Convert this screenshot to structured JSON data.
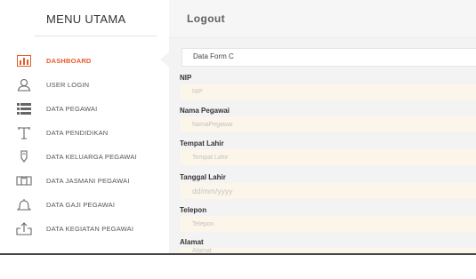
{
  "sidebar": {
    "title": "MENU UTAMA",
    "items": [
      {
        "label": "DASHBOARD",
        "icon": "dashboard-icon",
        "active": true
      },
      {
        "label": "USER LOGIN",
        "icon": "user-icon",
        "active": false
      },
      {
        "label": "DATA PEGAWAI",
        "icon": "list-icon",
        "active": false
      },
      {
        "label": "DATA PENDIDIKAN",
        "icon": "education-icon",
        "active": false
      },
      {
        "label": "DATA KELUARGA PEGAWAI",
        "icon": "family-icon",
        "active": false
      },
      {
        "label": "DATA JASMANI PEGAWAI",
        "icon": "fitness-icon",
        "active": false
      },
      {
        "label": "DATA GAJI PEGAWAI",
        "icon": "salary-icon",
        "active": false
      },
      {
        "label": "DATA KEGIATAN PEGAWAI",
        "icon": "activity-icon",
        "active": false
      }
    ]
  },
  "topbar": {
    "logout_label": "Logout"
  },
  "form": {
    "panel_title": "Data Form C",
    "fields": [
      {
        "label": "NIP",
        "placeholder": "NIP",
        "value": ""
      },
      {
        "label": "Nama Pegawai",
        "placeholder": "NamaPegawai",
        "value": ""
      },
      {
        "label": "Tempat Lahir",
        "placeholder": "Tempat Lahir",
        "value": ""
      },
      {
        "label": "Tanggal Lahir",
        "placeholder": "dd/mm/yyyy",
        "value": ""
      },
      {
        "label": "Telepon",
        "placeholder": "Telepon",
        "value": ""
      },
      {
        "label": "Alamat",
        "placeholder": "Alamat",
        "value": ""
      }
    ]
  },
  "colors": {
    "accent": "#e55a2b",
    "input_background": "#fbf5ea",
    "content_background": "#f3f3f3"
  }
}
